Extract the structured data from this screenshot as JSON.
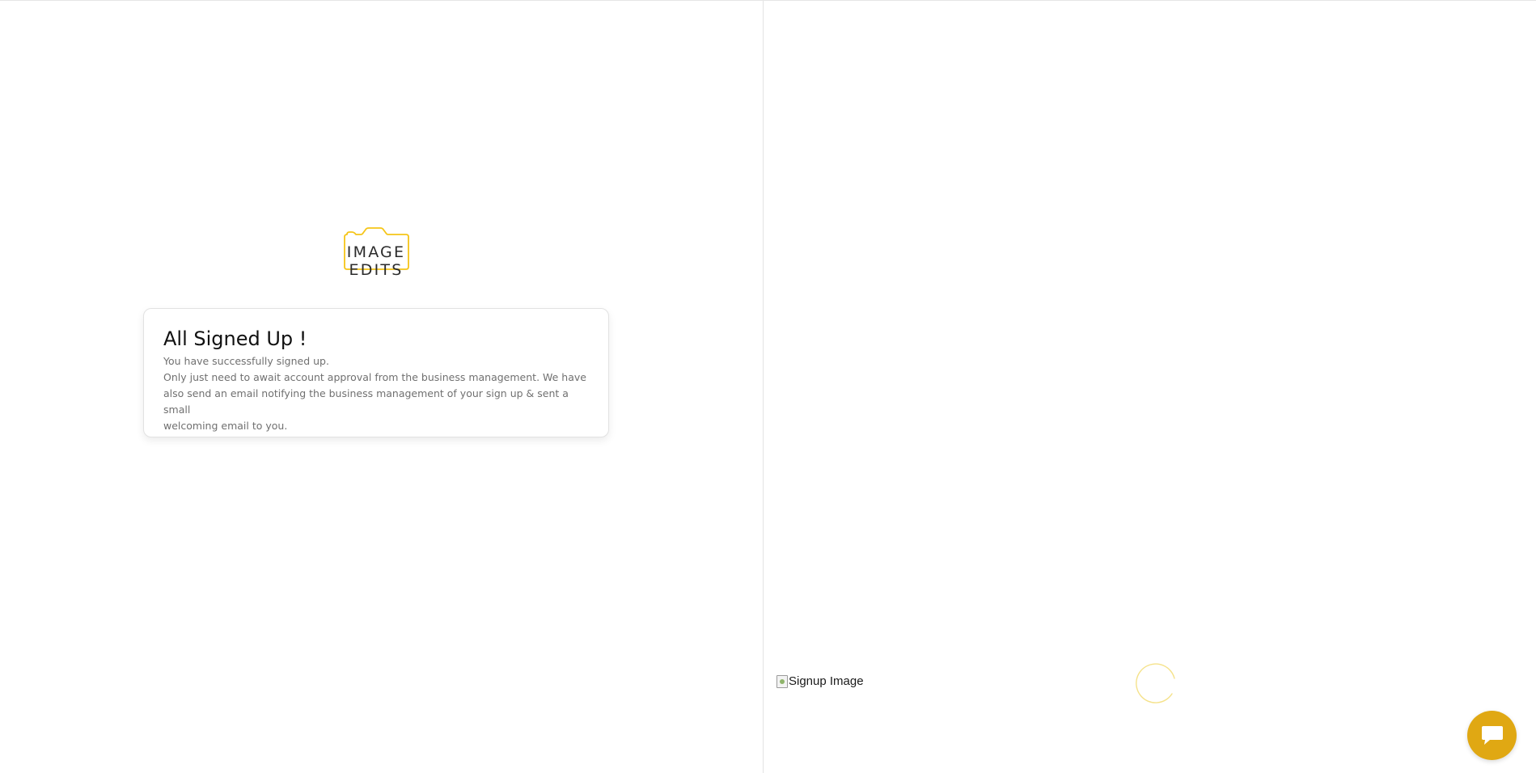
{
  "brand": {
    "logo_text": "IMAGE EDITS",
    "accent_color": "#f5c518"
  },
  "card": {
    "title": "All Signed Up !",
    "line_1": "You have successfully signed up.",
    "line_2": "Only just need to await account approval from the business management. We have",
    "line_3": "also send an email notifying the business management of your sign up & sent a small",
    "line_4": "welcoming email to you."
  },
  "right_pane": {
    "image_alt": "Signup Image",
    "spinner_color": "#f5e28a"
  },
  "chat": {
    "icon": "chat-bubble-icon",
    "color": "#e0a813"
  }
}
